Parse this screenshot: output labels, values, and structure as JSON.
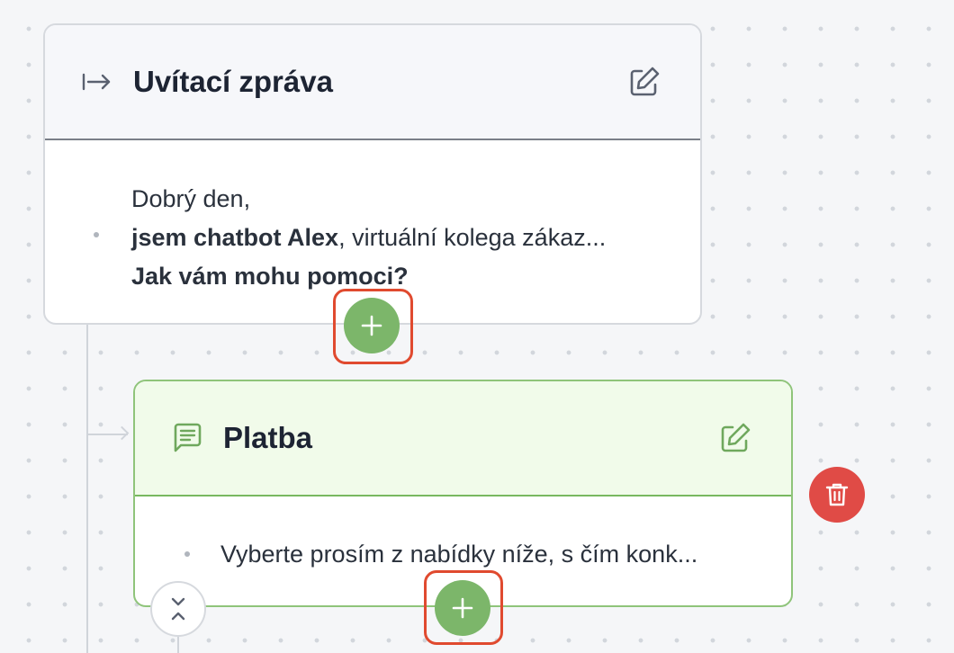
{
  "colors": {
    "canvas": "#f5f6f8",
    "accent_green": "#7cb66a",
    "highlight_red": "#e04a2f",
    "delete_red": "#e04b46"
  },
  "welcome_card": {
    "icon": "arrow-to-right-icon",
    "title": "Uvítací zpráva",
    "edit_icon": "edit-icon",
    "message": {
      "line1": "Dobrý den,",
      "line2_bold": "jsem chatbot Alex",
      "line2_rest": ", virtuální kolega zákaz...",
      "line3_bold": "Jak vám mohu pomoci?"
    },
    "add_icon": "plus-icon"
  },
  "platba_card": {
    "icon": "message-icon",
    "title": "Platba",
    "edit_icon": "edit-icon",
    "message": "Vyberte prosím z nabídky níže, s čím konk...",
    "add_icon": "plus-icon"
  },
  "delete_icon": "trash-icon",
  "collapse_icon": "collapse-icon"
}
